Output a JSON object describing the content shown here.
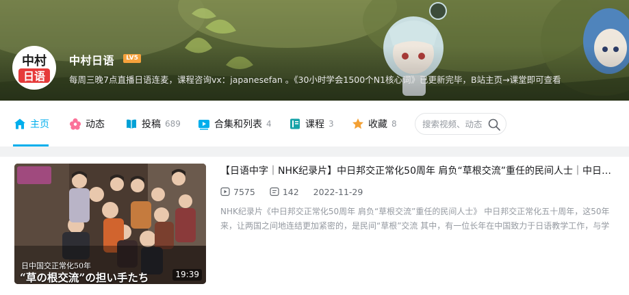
{
  "profile": {
    "name": "中村日语",
    "level_badge": "LV5",
    "avatar_text_top": "中村",
    "avatar_text_bottom": "日语",
    "sign": "每周三晚7点直播日语连麦，课程咨询vx：japanesefan 。《30小时学会1500个N1核心词》已更新完毕，B站主页→课堂即可查看"
  },
  "nav": {
    "items": [
      {
        "label": "主页",
        "icon": "home-icon",
        "count": ""
      },
      {
        "label": "动态",
        "icon": "dynamic-icon",
        "count": ""
      },
      {
        "label": "投稿",
        "icon": "upload-icon",
        "count": "689"
      },
      {
        "label": "合集和列表",
        "icon": "collection-icon",
        "count": "4"
      },
      {
        "label": "课程",
        "icon": "course-icon",
        "count": "3"
      },
      {
        "label": "收藏",
        "icon": "star-icon",
        "count": "8"
      }
    ],
    "active_index": 0,
    "search_placeholder": "搜索视频、动态"
  },
  "video": {
    "title": "【日语中字｜NHK纪录片】中日邦交正常化50周年 肩负“草根交流”重任的民间人士｜中日邦交正常化五十周年",
    "views": "7575",
    "comments": "142",
    "date": "2022-11-29",
    "description": "NHK纪录片《中日邦交正常化50周年 肩负“草根交流”重任的民间人士》 中日邦交正常化五十周年，这50年来，让两国之间地连结更加紧密的，是民间“草根”交流 其中，有一位长年在中国致力于日语教学工作，与学",
    "duration": "19:39",
    "thumb_caption_line1": "日中国交正常化50年",
    "thumb_caption_line2": "“草の根交流”の担い手たち"
  },
  "colors": {
    "accent": "#00aeec",
    "level_badge": "#f6a23c",
    "text_primary": "#18191c",
    "text_secondary": "#9499a0"
  }
}
